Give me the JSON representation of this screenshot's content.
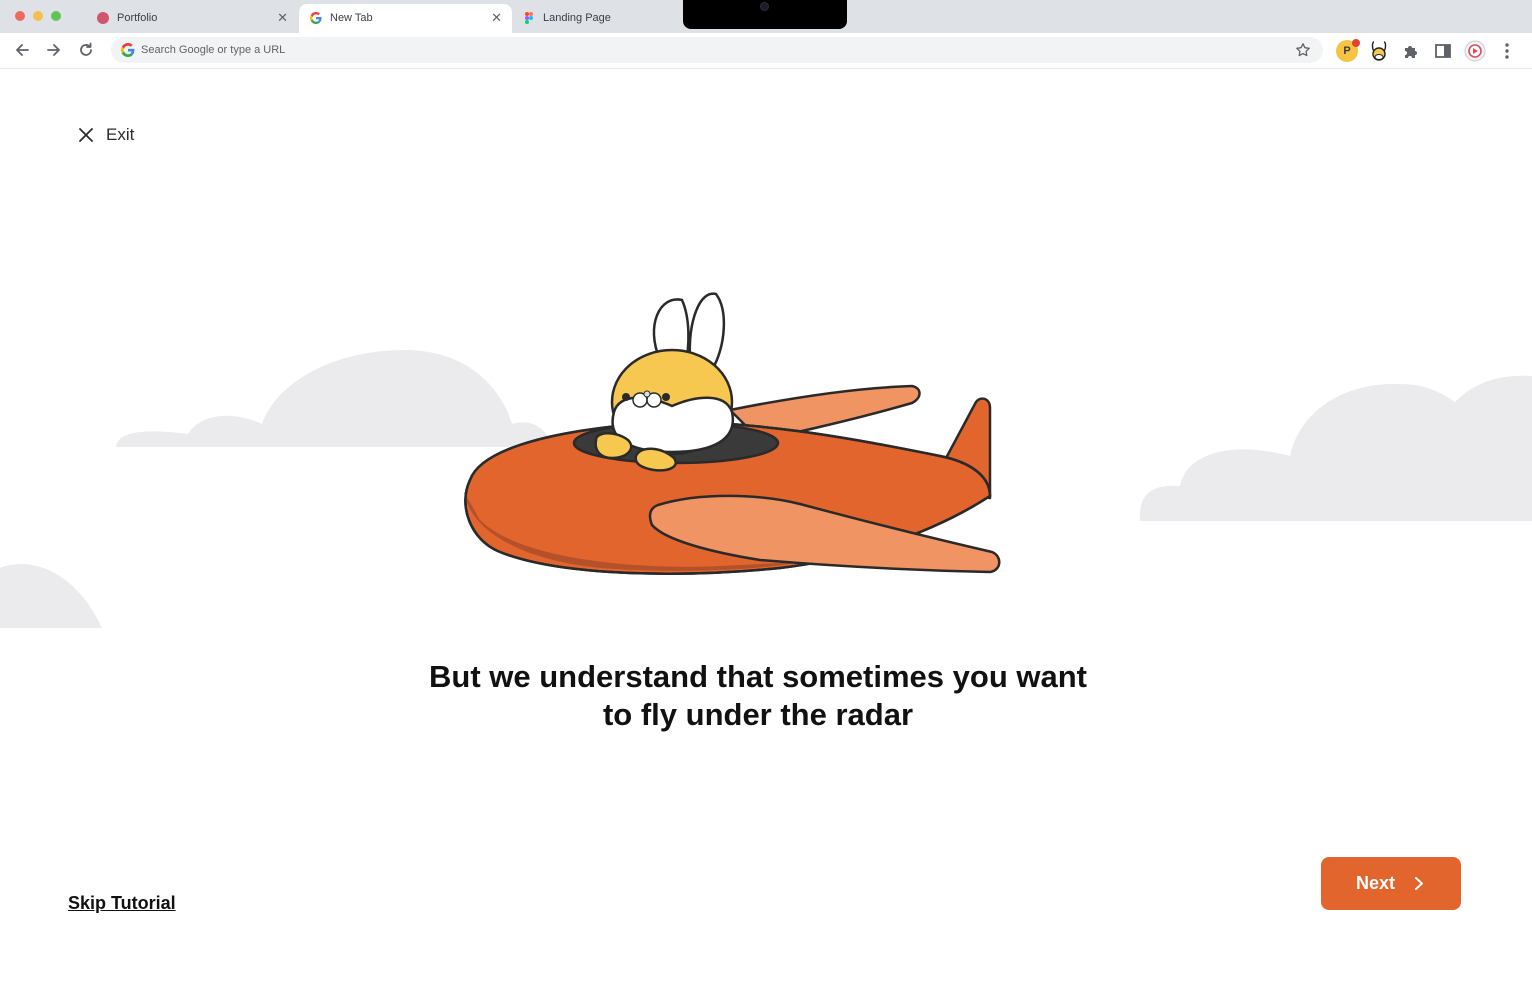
{
  "browser": {
    "tabs": [
      {
        "title": "Portfolio",
        "icon": "portfolio-favicon"
      },
      {
        "title": "New Tab",
        "icon": "google-favicon"
      },
      {
        "title": "Landing Page",
        "icon": "figma-favicon"
      }
    ],
    "omnibox_placeholder": "Search Google or type a URL",
    "extension_initial": "P"
  },
  "page": {
    "exit_label": "Exit",
    "headline_line1": "But we understand that sometimes you want",
    "headline_line2": "to fly under the radar",
    "skip_label": "Skip Tutorial",
    "next_label": "Next"
  },
  "colors": {
    "accent": "#e2652e",
    "plane_body": "#e2652e",
    "plane_wing": "#f09464",
    "bunny_yellow": "#f6c84f",
    "cloud": "#ebebed"
  }
}
